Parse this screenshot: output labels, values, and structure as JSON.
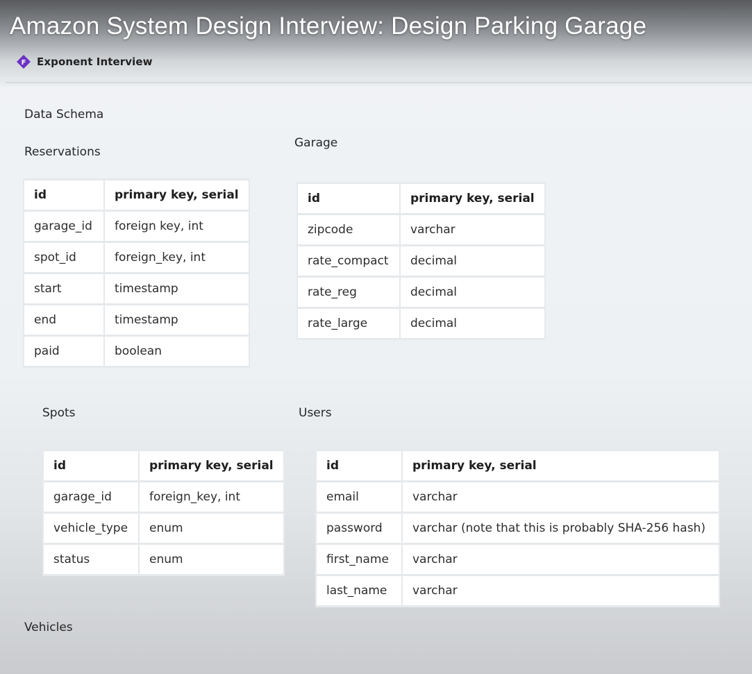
{
  "video": {
    "title": "Amazon System Design Interview: Design Parking Garage",
    "channel": "Exponent Interview",
    "channel_logo_letter": "F",
    "accent": "#6b33c4"
  },
  "page": {
    "heading": "Data Schema",
    "footer_label": "Vehicles"
  },
  "tables": {
    "reservations": {
      "title": "Reservations",
      "rows": [
        [
          "id",
          "primary key, serial"
        ],
        [
          "garage_id",
          "foreign key, int"
        ],
        [
          "spot_id",
          "foreign_key, int"
        ],
        [
          "start",
          "timestamp"
        ],
        [
          "end",
          "timestamp"
        ],
        [
          "paid",
          "boolean"
        ]
      ]
    },
    "garage": {
      "title": "Garage",
      "rows": [
        [
          "id",
          "primary key, serial"
        ],
        [
          "zipcode",
          "varchar"
        ],
        [
          "rate_compact",
          "decimal"
        ],
        [
          "rate_reg",
          "decimal"
        ],
        [
          "rate_large",
          "decimal"
        ]
      ]
    },
    "spots": {
      "title": "Spots",
      "rows": [
        [
          "id",
          "primary key, serial"
        ],
        [
          "garage_id",
          "foreign_key, int"
        ],
        [
          "vehicle_type",
          "enum"
        ],
        [
          "status",
          "enum"
        ]
      ]
    },
    "users": {
      "title": "Users",
      "rows": [
        [
          "id",
          "primary key, serial"
        ],
        [
          "email",
          "varchar"
        ],
        [
          "password",
          "varchar (note that this is probably SHA-256 hash)"
        ],
        [
          "first_name",
          "varchar"
        ],
        [
          "last_name",
          "varchar"
        ]
      ]
    }
  }
}
